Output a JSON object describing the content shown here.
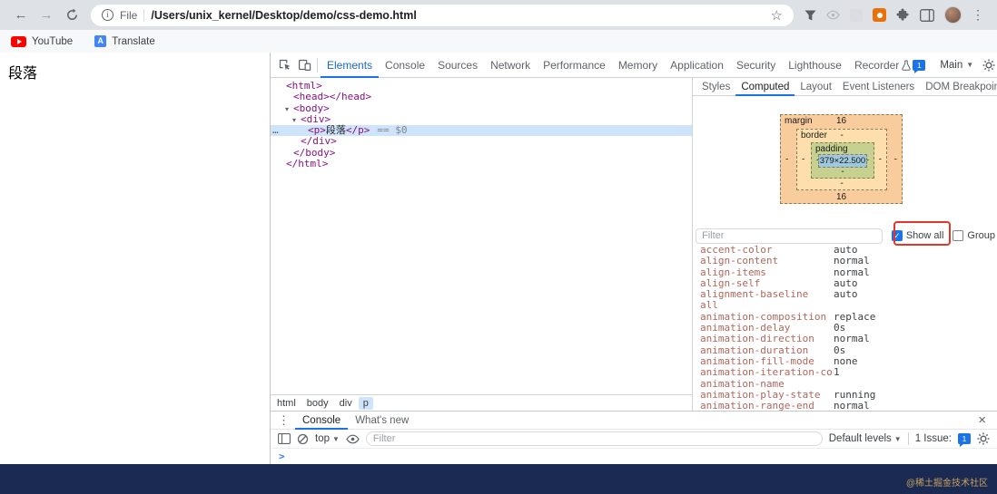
{
  "browser": {
    "address": {
      "scheme_label": "File",
      "path": "/Users/unix_kernel/Desktop/demo/css-demo.html"
    },
    "bookmarks": [
      {
        "label": "YouTube"
      },
      {
        "label": "Translate"
      }
    ]
  },
  "page": {
    "paragraph": "段落"
  },
  "devtools": {
    "tabs": [
      "Elements",
      "Console",
      "Sources",
      "Network",
      "Performance",
      "Memory",
      "Application",
      "Security",
      "Lighthouse",
      "Recorder"
    ],
    "selected_tab": "Elements",
    "issues_count": "1",
    "context_label": "Main",
    "elements": {
      "tree": [
        {
          "indent": 0,
          "arrow": "",
          "parts": [
            {
              "type": "tag",
              "text": "<html>"
            }
          ]
        },
        {
          "indent": 1,
          "arrow": "",
          "parts": [
            {
              "type": "tag",
              "text": "<head></head>"
            }
          ]
        },
        {
          "indent": 1,
          "arrow": "▾",
          "parts": [
            {
              "type": "tag",
              "text": "<body>"
            }
          ]
        },
        {
          "indent": 2,
          "arrow": "▾",
          "parts": [
            {
              "type": "tag",
              "text": "<div>"
            }
          ]
        },
        {
          "indent": 3,
          "arrow": "",
          "selected": true,
          "gutter": "…",
          "parts": [
            {
              "type": "tag",
              "text": "<p>"
            },
            {
              "type": "text",
              "text": "段落"
            },
            {
              "type": "tag",
              "text": "</p>"
            }
          ],
          "suffix": "== $0"
        },
        {
          "indent": 2,
          "arrow": "",
          "parts": [
            {
              "type": "tag",
              "text": "</div>"
            }
          ]
        },
        {
          "indent": 1,
          "arrow": "",
          "parts": [
            {
              "type": "tag",
              "text": "</body>"
            }
          ]
        },
        {
          "indent": 0,
          "arrow": "",
          "parts": [
            {
              "type": "tag",
              "text": "</html>"
            }
          ]
        }
      ],
      "breadcrumb": [
        "html",
        "body",
        "div",
        "p"
      ],
      "breadcrumb_selected": "p"
    },
    "sidebar": {
      "tabs": [
        "Styles",
        "Computed",
        "Layout",
        "Event Listeners",
        "DOM Breakpoints"
      ],
      "selected_tab": "Computed",
      "overflow_label": "»"
    },
    "box_model": {
      "margin_label": "margin",
      "margin_top": "16",
      "margin_right": "-",
      "margin_bottom": "16",
      "margin_left": "-",
      "border_label": "border",
      "border_top": "-",
      "border_right": "-",
      "border_bottom": "-",
      "border_left": "-",
      "padding_label": "padding",
      "padding_top": "-",
      "padding_right": "-",
      "padding_bottom": "-",
      "padding_left": "-",
      "content_size": "379×22.500"
    },
    "computed": {
      "filter_placeholder": "Filter",
      "show_all_label": "Show all",
      "show_all_checked": true,
      "group_label": "Group",
      "group_checked": false,
      "properties": [
        {
          "name": "accent-color",
          "value": "auto"
        },
        {
          "name": "align-content",
          "value": "normal"
        },
        {
          "name": "align-items",
          "value": "normal"
        },
        {
          "name": "align-self",
          "value": "auto"
        },
        {
          "name": "alignment-baseline",
          "value": "auto"
        },
        {
          "name": "all",
          "value": ""
        },
        {
          "name": "animation-composition",
          "value": "replace"
        },
        {
          "name": "animation-delay",
          "value": "0s"
        },
        {
          "name": "animation-direction",
          "value": "normal"
        },
        {
          "name": "animation-duration",
          "value": "0s"
        },
        {
          "name": "animation-fill-mode",
          "value": "none"
        },
        {
          "name": "animation-iteration-count",
          "value": "1"
        },
        {
          "name": "animation-name",
          "value": ""
        },
        {
          "name": "animation-play-state",
          "value": "running"
        },
        {
          "name": "animation-range-end",
          "value": "normal"
        }
      ]
    }
  },
  "console": {
    "tabs": [
      "Console",
      "What's new"
    ],
    "selected_tab": "Console",
    "context_label": "top",
    "filter_placeholder": "Filter",
    "levels_label": "Default levels",
    "issues_label": "1 Issue:",
    "issues_count": "1",
    "prompt": ">"
  },
  "watermark": "@稀土掘金技术社区"
}
